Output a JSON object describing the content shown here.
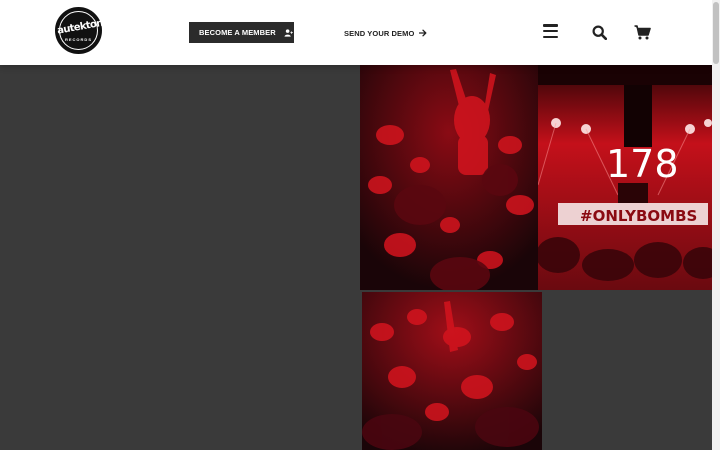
{
  "header": {
    "logo": {
      "wordmark": "autektone",
      "subtext": "RECORDS",
      "icon": "autektone-records-logo"
    },
    "member_button": {
      "label": "BECOME A MEMBER",
      "icon": "user-plus-icon"
    },
    "demo_link": {
      "label": "SEND YOUR DEMO",
      "icon": "arrow-right-icon"
    },
    "menu_icon": "hamburger-menu-icon",
    "search_icon": "search-icon",
    "cart_icon": "shopping-cart-icon"
  },
  "gallery": {
    "photos": [
      {
        "name": "crowd-hands-raised-photo",
        "tint": "#c8102e"
      },
      {
        "name": "stage-dj-photo",
        "stage_text": "178",
        "banner_text": "#ONLYBOMBS",
        "tint": "#e01b1b"
      },
      {
        "name": "crowd-dancing-photo",
        "tint": "#c8102e"
      }
    ]
  },
  "colors": {
    "page_background": "#3a3a3a",
    "header_background": "#ffffff",
    "button_background": "#2b2b2b",
    "photo_red": "#d4141e",
    "photo_dark": "#1a0508"
  }
}
